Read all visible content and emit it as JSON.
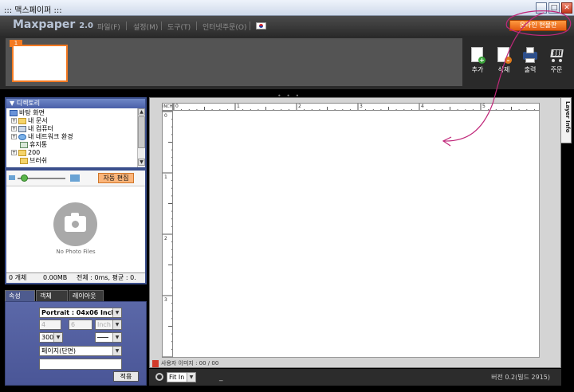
{
  "window": {
    "title": "::: 맥스페이퍼 :::"
  },
  "app": {
    "logo": "Maxpaper",
    "version": "2.0"
  },
  "menu": {
    "items": [
      "파일(F)",
      "설정(M)",
      "도구(T)",
      "인터넷주문(O)"
    ],
    "order_online": "온라인 현물판"
  },
  "thumbnails": {
    "page_number": "1"
  },
  "toolbar": {
    "add": "추가",
    "delete": "삭제",
    "print": "출력",
    "order": "주문"
  },
  "directory": {
    "title": "디렉토리",
    "tree": [
      {
        "label": "바탕 화면",
        "icon": "desktop-icon",
        "depth": 0,
        "expander": ""
      },
      {
        "label": "내 문서",
        "icon": "folder-icon",
        "depth": 1,
        "expander": "+"
      },
      {
        "label": "내 컴퓨터",
        "icon": "computer-icon",
        "depth": 1,
        "expander": "+"
      },
      {
        "label": "내 네트워크 환경",
        "icon": "network-icon",
        "depth": 1,
        "expander": "+"
      },
      {
        "label": "휴지통",
        "icon": "recycle-bin-icon",
        "depth": 1,
        "expander": ""
      },
      {
        "label": "200",
        "icon": "folder-icon",
        "depth": 1,
        "expander": "+"
      },
      {
        "label": "브러쉬",
        "icon": "folder-icon",
        "depth": 1,
        "expander": ""
      }
    ]
  },
  "preview": {
    "auto_edit": "자동 편집",
    "no_photo": "No Photo Files",
    "stats": {
      "count": "0 개체",
      "size": "0.00MB",
      "total": "전체 : 0ms, 평균 : 0."
    }
  },
  "properties": {
    "tabs": [
      "속성",
      "객체",
      "레이아웃"
    ],
    "paper_size": "Portrait : 04x06 Inch",
    "width": "4",
    "height": "6",
    "unit": "Inch",
    "dpi": "300",
    "page_type": "페이지(단면)",
    "apply": "적용"
  },
  "canvas": {
    "ruler_unit": "INCH",
    "top_ticks": [
      "0",
      "1",
      "2",
      "3",
      "4",
      "5"
    ],
    "left_ticks": [
      "0",
      "1",
      "2",
      "3"
    ],
    "used_images": "사용자 이미지 : 00 / 00"
  },
  "layer_info": {
    "label": "Layer Info"
  },
  "status": {
    "fit": "Fit In",
    "underscore": "_",
    "version": "버전 0.2(빌드 2915)"
  },
  "colors": {
    "accent_orange": "#f47a22",
    "panel_blue": "#4a5697",
    "annotation_magenta": "#c0287a"
  }
}
